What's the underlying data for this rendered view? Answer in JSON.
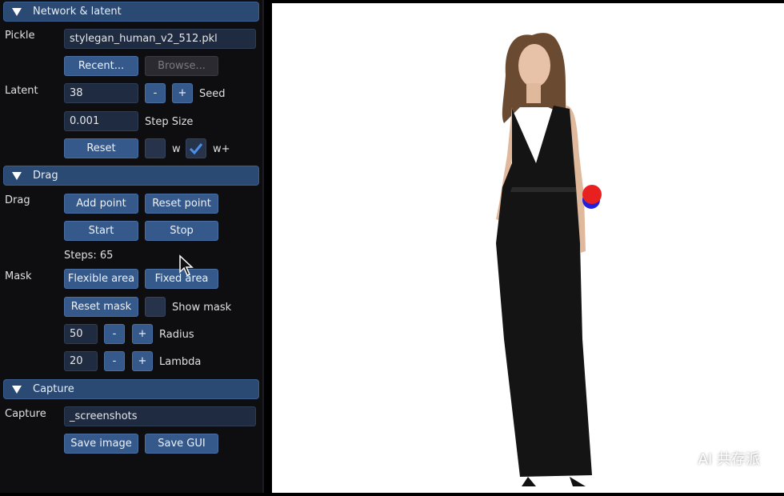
{
  "sections": {
    "network": "Network & latent",
    "drag": "Drag",
    "capture": "Capture"
  },
  "network": {
    "pickle_label": "Pickle",
    "pickle_value": "stylegan_human_v2_512.pkl",
    "recent": "Recent...",
    "browse": "Browse...",
    "latent_label": "Latent",
    "seed_value": "38",
    "minus": "-",
    "plus": "+",
    "seed_label": "Seed",
    "step_value": "0.001",
    "step_label": "Step Size",
    "reset": "Reset",
    "w_label": "w",
    "wplus_label": "w+",
    "w_checked": false,
    "wplus_checked": true
  },
  "drag": {
    "drag_label": "Drag",
    "add_point": "Add point",
    "reset_point": "Reset point",
    "start": "Start",
    "stop": "Stop",
    "steps": "Steps: 65",
    "mask_label": "Mask",
    "flexible": "Flexible area",
    "fixed": "Fixed area",
    "reset_mask": "Reset mask",
    "show_mask": "Show mask",
    "show_mask_checked": false,
    "radius_value": "50",
    "radius_label": "Radius",
    "lambda_value": "20",
    "lambda_label": "Lambda",
    "minus": "-",
    "plus": "+"
  },
  "capture": {
    "capture_label": "Capture",
    "dir_value": "_screenshots",
    "save_image": "Save image",
    "save_gui": "Save GUI"
  },
  "canvas": {
    "handle_point_color": "#e82020",
    "target_point_color": "#2020e0"
  },
  "watermark": "AI 共存派",
  "colors": {
    "header": "#2a4a74",
    "button": "#35598a",
    "input": "#1f2b40",
    "panel": "#0e0e11"
  }
}
